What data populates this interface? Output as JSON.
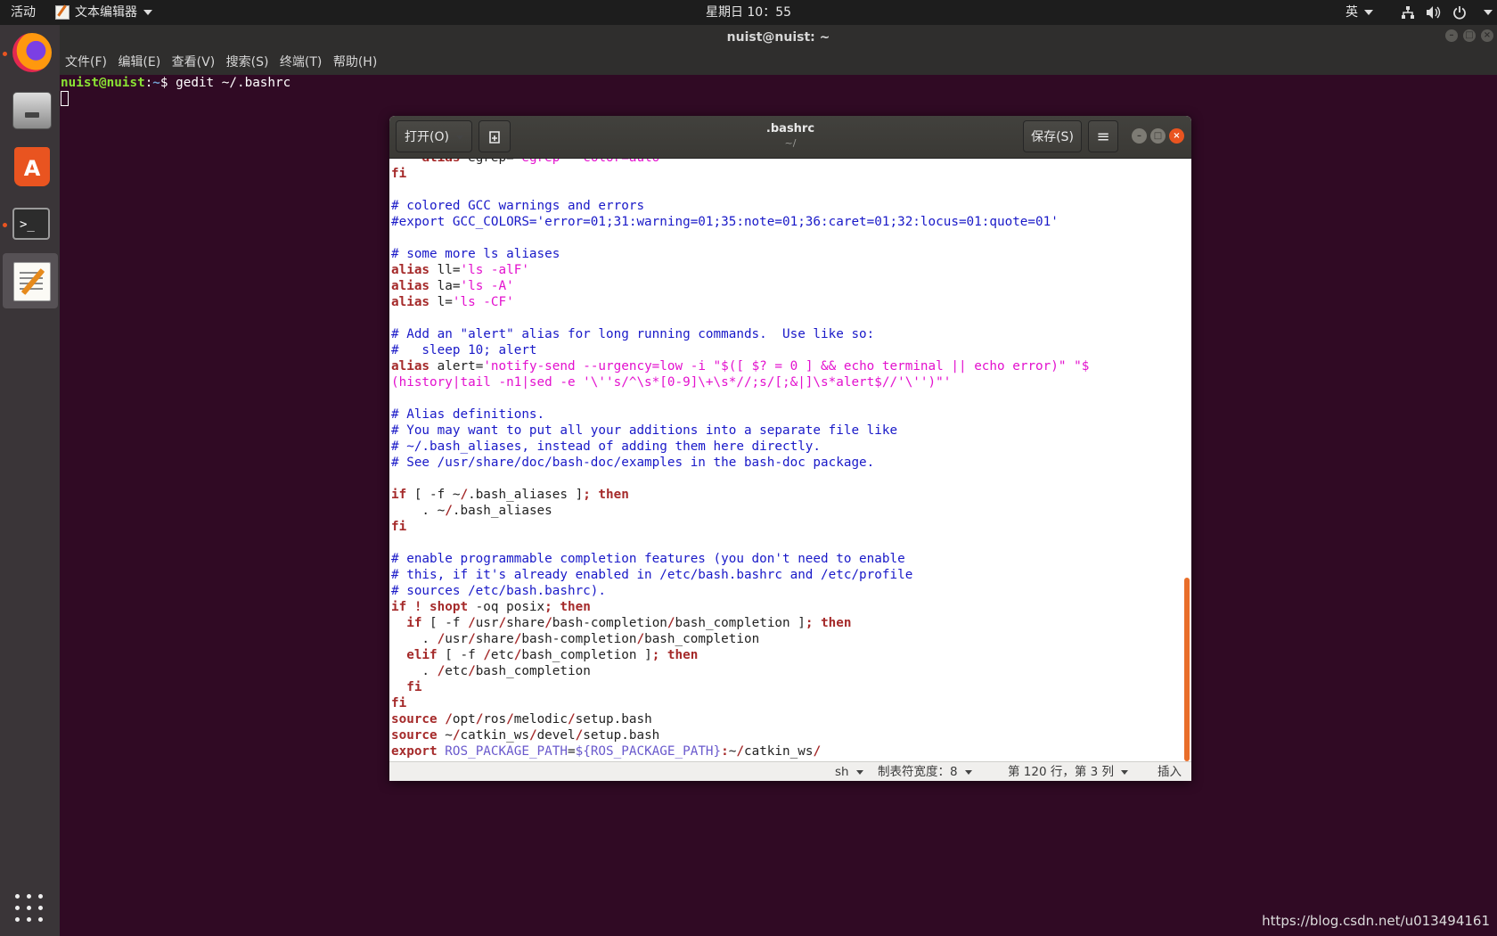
{
  "topbar": {
    "activities": "活动",
    "app_menu": "文本编辑器",
    "clock": "星期日 10：55",
    "lang": "英",
    "system_icons": [
      "network-icon",
      "volume-icon",
      "power-icon"
    ]
  },
  "dock": {
    "items": [
      "firefox-icon",
      "files-icon",
      "software-center-icon",
      "terminal-icon",
      "text-editor-icon",
      "show-apps-icon"
    ]
  },
  "terminal": {
    "title": "nuist@nuist: ~",
    "menu": [
      "文件(F)",
      "编辑(E)",
      "查看(V)",
      "搜索(S)",
      "终端(T)",
      "帮助(H)"
    ],
    "prompt_user": "nuist@nuist",
    "prompt_path": "~",
    "command": "$ gedit ~/.bashrc"
  },
  "gedit": {
    "open_label": "打开(O)",
    "save_label": "保存(S)",
    "title": ".bashrc",
    "subtitle": "~/",
    "status": {
      "language": "sh",
      "tab_width": "制表符宽度：8",
      "position": "第 120 行，第 3 列",
      "mode": "插入"
    }
  },
  "code_lines": [
    [
      [
        "p",
        "    "
      ],
      [
        "k",
        "alias"
      ],
      [
        "p",
        " egrep="
      ],
      [
        "s",
        "'egrep --color=auto'"
      ]
    ],
    [
      [
        "k",
        "fi"
      ]
    ],
    [],
    [
      [
        "c",
        "# colored GCC warnings and errors"
      ]
    ],
    [
      [
        "c",
        "#export GCC_COLORS='error=01;31:warning=01;35:note=01;36:caret=01;32:locus=01:quote=01'"
      ]
    ],
    [],
    [
      [
        "c",
        "# some more ls aliases"
      ]
    ],
    [
      [
        "k",
        "alias"
      ],
      [
        "p",
        " ll="
      ],
      [
        "s",
        "'ls -alF'"
      ]
    ],
    [
      [
        "k",
        "alias"
      ],
      [
        "p",
        " la="
      ],
      [
        "s",
        "'ls -A'"
      ]
    ],
    [
      [
        "k",
        "alias"
      ],
      [
        "p",
        " l="
      ],
      [
        "s",
        "'ls -CF'"
      ]
    ],
    [],
    [
      [
        "c",
        "# Add an \"alert\" alias for long running commands.  Use like so:"
      ]
    ],
    [
      [
        "c",
        "#   sleep 10; alert"
      ]
    ],
    [
      [
        "k",
        "alias"
      ],
      [
        "p",
        " alert="
      ],
      [
        "s",
        "'notify-send --urgency=low -i \"$([ $? = 0 ] && echo terminal || echo error)\" \"$"
      ]
    ],
    [
      [
        "s",
        "(history|tail -n1|sed -e '\\''s/^\\s*[0-9]\\+\\s*//;s/[;&|]\\s*alert$//'\\'')\"'"
      ]
    ],
    [],
    [
      [
        "c",
        "# Alias definitions."
      ]
    ],
    [
      [
        "c",
        "# You may want to put all your additions into a separate file like"
      ]
    ],
    [
      [
        "c",
        "# ~/.bash_aliases, instead of adding them here directly."
      ]
    ],
    [
      [
        "c",
        "# See /usr/share/doc/bash-doc/examples in the bash-doc package."
      ]
    ],
    [],
    [
      [
        "k",
        "if"
      ],
      [
        "p",
        " [ -f ~"
      ],
      [
        "k",
        "/"
      ],
      [
        "p",
        ".bash_aliases ]"
      ],
      [
        "k",
        "; then"
      ]
    ],
    [
      [
        "p",
        "    . ~"
      ],
      [
        "k",
        "/"
      ],
      [
        "p",
        ".bash_aliases"
      ]
    ],
    [
      [
        "k",
        "fi"
      ]
    ],
    [],
    [
      [
        "c",
        "# enable programmable completion features (you don't need to enable"
      ]
    ],
    [
      [
        "c",
        "# this, if it's already enabled in /etc/bash.bashrc and /etc/profile"
      ]
    ],
    [
      [
        "c",
        "# sources /etc/bash.bashrc)."
      ]
    ],
    [
      [
        "k",
        "if ! shopt"
      ],
      [
        "p",
        " -oq posix"
      ],
      [
        "k",
        "; then"
      ]
    ],
    [
      [
        "p",
        "  "
      ],
      [
        "k",
        "if"
      ],
      [
        "p",
        " [ -f "
      ],
      [
        "k",
        "/"
      ],
      [
        "p",
        "usr"
      ],
      [
        "k",
        "/"
      ],
      [
        "p",
        "share"
      ],
      [
        "k",
        "/"
      ],
      [
        "p",
        "bash-completion"
      ],
      [
        "k",
        "/"
      ],
      [
        "p",
        "bash_completion ]"
      ],
      [
        "k",
        "; then"
      ]
    ],
    [
      [
        "p",
        "    . "
      ],
      [
        "k",
        "/"
      ],
      [
        "p",
        "usr"
      ],
      [
        "k",
        "/"
      ],
      [
        "p",
        "share"
      ],
      [
        "k",
        "/"
      ],
      [
        "p",
        "bash-completion"
      ],
      [
        "k",
        "/"
      ],
      [
        "p",
        "bash_completion"
      ]
    ],
    [
      [
        "p",
        "  "
      ],
      [
        "k",
        "elif"
      ],
      [
        "p",
        " [ -f "
      ],
      [
        "k",
        "/"
      ],
      [
        "p",
        "etc"
      ],
      [
        "k",
        "/"
      ],
      [
        "p",
        "bash_completion ]"
      ],
      [
        "k",
        "; then"
      ]
    ],
    [
      [
        "p",
        "    . "
      ],
      [
        "k",
        "/"
      ],
      [
        "p",
        "etc"
      ],
      [
        "k",
        "/"
      ],
      [
        "p",
        "bash_completion"
      ]
    ],
    [
      [
        "p",
        "  "
      ],
      [
        "k",
        "fi"
      ]
    ],
    [
      [
        "k",
        "fi"
      ]
    ],
    [
      [
        "k",
        "source /"
      ],
      [
        "p",
        "opt"
      ],
      [
        "k",
        "/"
      ],
      [
        "p",
        "ros"
      ],
      [
        "k",
        "/"
      ],
      [
        "p",
        "melodic"
      ],
      [
        "k",
        "/"
      ],
      [
        "p",
        "setup.bash"
      ]
    ],
    [
      [
        "k",
        "source"
      ],
      [
        "p",
        " ~"
      ],
      [
        "k",
        "/"
      ],
      [
        "p",
        "catkin_ws"
      ],
      [
        "k",
        "/"
      ],
      [
        "p",
        "devel"
      ],
      [
        "k",
        "/"
      ],
      [
        "p",
        "setup.bash"
      ]
    ],
    [
      [
        "k",
        "export"
      ],
      [
        "p",
        " "
      ],
      [
        "v",
        "ROS_PACKAGE_PATH"
      ],
      [
        "p",
        "="
      ],
      [
        "v",
        "${ROS_PACKAGE_PATH}"
      ],
      [
        "k",
        ":"
      ],
      [
        "p",
        "~"
      ],
      [
        "k",
        "/"
      ],
      [
        "p",
        "catkin_ws"
      ],
      [
        "k",
        "/"
      ]
    ]
  ],
  "watermark": "https://blog.csdn.net/u013494161"
}
